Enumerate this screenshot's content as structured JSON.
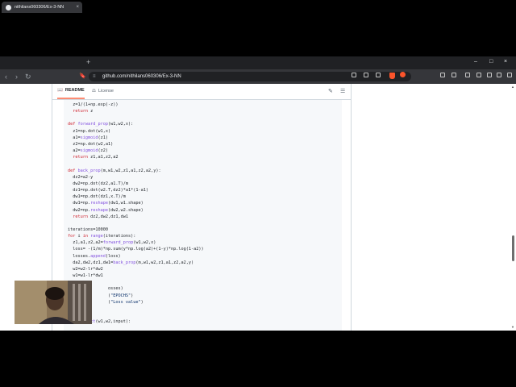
{
  "browser": {
    "tab_title": "nithilans060306/Ex-3-NN",
    "tab_close": "×",
    "new_tab": "+",
    "window_controls": {
      "minimize": "–",
      "maximize": "□",
      "close": "×"
    },
    "url": "github.com/nithilans060306/Ex-3-NN",
    "nav": {
      "back": "‹",
      "forward": "›",
      "reload": "↻"
    },
    "bookmark_icon": "🔖",
    "tune_icon": "≡"
  },
  "readme": {
    "tabs": [
      {
        "label": "README",
        "icon": "book-icon"
      },
      {
        "label": "License",
        "icon": "scale-icon"
      }
    ],
    "edit_icon": "✎",
    "toc_icon": "☰"
  },
  "code_lines": [
    "  z=1/(1+np.exp(-z))",
    "  return z",
    "",
    "def forward_prop(w1,w2,x):",
    "  z1=np.dot(w1,x)",
    "  a1=sigmoid(z1)",
    "  z2=np.dot(w2,a1)",
    "  a2=sigmoid(z2)",
    "  return z1,a1,z2,a2",
    "",
    "def back_prop(m,w1,w2,z1,a1,z2,a2,y):",
    "  dz2=a2-y",
    "  dw2=np.dot(dz2,a1.T)/m",
    "  dz1=np.dot(w2.T,dz2)*a1*(1-a1)",
    "  dw1=np.dot(dz1,x.T)/m",
    "  dw1=np.reshape(dw1,w1.shape)",
    "  dw2=np.reshape(dw2,w2.shape)",
    "  return dz2,dw2,dz1,dw1",
    "",
    "iterations=10000",
    "for i in range(iterations):",
    "  z1,a1,z2,a2=forward_prop(w1,w2,x)",
    "  loss= -(1/m)*np.sum(y*np.log(a2)+(1-y)*np.log(1-a2))",
    "  losses.append(loss)",
    "  da2,dw2,dz1,dw1=back_prop(m,w1,w2,z1,a1,z2,a2,y)",
    "  w2=w2-lr*dw2",
    "  w1=w1-lr*dw1",
    "",
    "                osses)",
    "                (\"EPOCHS\")",
    "                (\"Loss value\")",
    "",
    "",
    "def predict(w1,w2,input):"
  ],
  "scrollbar": {
    "up": "▲",
    "down": "▼"
  }
}
